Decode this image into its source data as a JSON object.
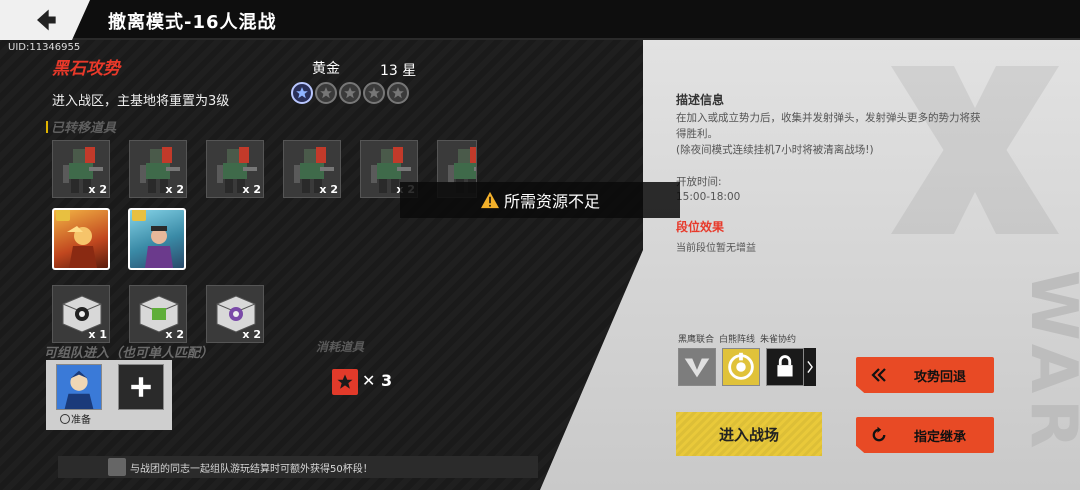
{
  "header": {
    "title": "撤离模式-16人混战",
    "uid": "UID:11346955"
  },
  "mode": {
    "name": "黑石攻势",
    "reset_note": "进入战区，主基地将重置为3级",
    "rank_tier": "黄金",
    "rank_stars": "13 星",
    "stars_filled": 1,
    "stars_total": 5
  },
  "carried_items": {
    "label": "已转移道具",
    "units": [
      {
        "icon": "mech-soldier",
        "qty": "x 2"
      },
      {
        "icon": "mech-soldier",
        "qty": "x 2"
      },
      {
        "icon": "mech-soldier",
        "qty": "x 2"
      },
      {
        "icon": "mech-soldier",
        "qty": "x 2"
      },
      {
        "icon": "mech-soldier",
        "qty": "x 2"
      },
      {
        "icon": "mech-soldier",
        "qty": ""
      }
    ],
    "heroes": [
      {
        "icon": "hero-fire-warrior"
      },
      {
        "icon": "hero-purple-commander"
      }
    ],
    "boxes": [
      {
        "icon": "supply-box-black",
        "qty": "x 1"
      },
      {
        "icon": "supply-box-green",
        "qty": "x 2"
      },
      {
        "icon": "supply-box-purple",
        "qty": "x 2"
      }
    ]
  },
  "team": {
    "label": "可组队进入（也可单人匹配）",
    "ready_label": "准备"
  },
  "consume": {
    "label": "消耗道具",
    "qty": "✕ 3"
  },
  "bottom_tip": "与战团的同志一起组队游玩结算时可额外获得50杯段！",
  "toast": {
    "text": "所需资源不足"
  },
  "description": {
    "title": "描述信息",
    "body": "在加入或成立势力后，收集并发射弹头，发射弹头更多的势力将获得胜利。",
    "note": "(除夜间模式连续挂机7小时将被清离战场!)",
    "open_label": "开放时间:",
    "open_time": "15:00-18:00",
    "rank_effect_title": "段位效果",
    "rank_effect_note": "当前段位暂无增益"
  },
  "factions": {
    "labels": [
      "黑鹰联合",
      "白熊阵线",
      "朱雀协约"
    ]
  },
  "buttons": {
    "enter": "进入战场",
    "retreat": "攻势回退",
    "inherit": "指定继承"
  },
  "watermark": "WAR",
  "colors": {
    "accent_red": "#e84a25",
    "accent_yellow": "#e9c93a",
    "mode_red": "#e8392a"
  }
}
